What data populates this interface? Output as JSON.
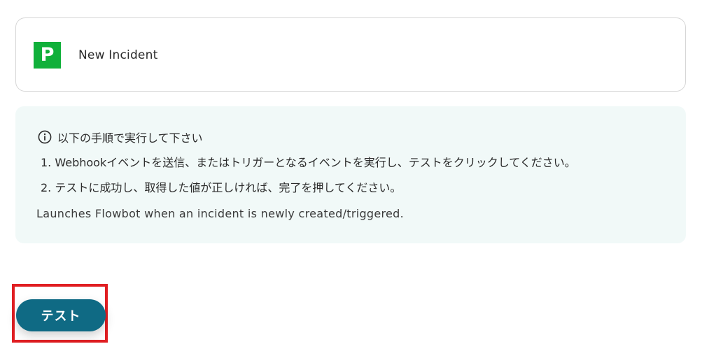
{
  "trigger": {
    "logo_letter": "P",
    "logo_color": "#10b03a",
    "name": "New Incident"
  },
  "instructions": {
    "icon": "info-circle-icon",
    "heading": "以下の手順で実行して下さい",
    "steps": [
      "1. Webhookイベントを送信、またはトリガーとなるイベントを実行し、テストをクリックしてください。",
      "2. テストに成功し、取得した値が正しければ、完了を押してください。"
    ],
    "description": "Launches Flowbot when an incident is newly created/triggered.",
    "background_color": "#f1f9f8"
  },
  "actions": {
    "test_label": "テスト",
    "test_color": "#0f6a84",
    "highlight_color": "#e01e22"
  }
}
